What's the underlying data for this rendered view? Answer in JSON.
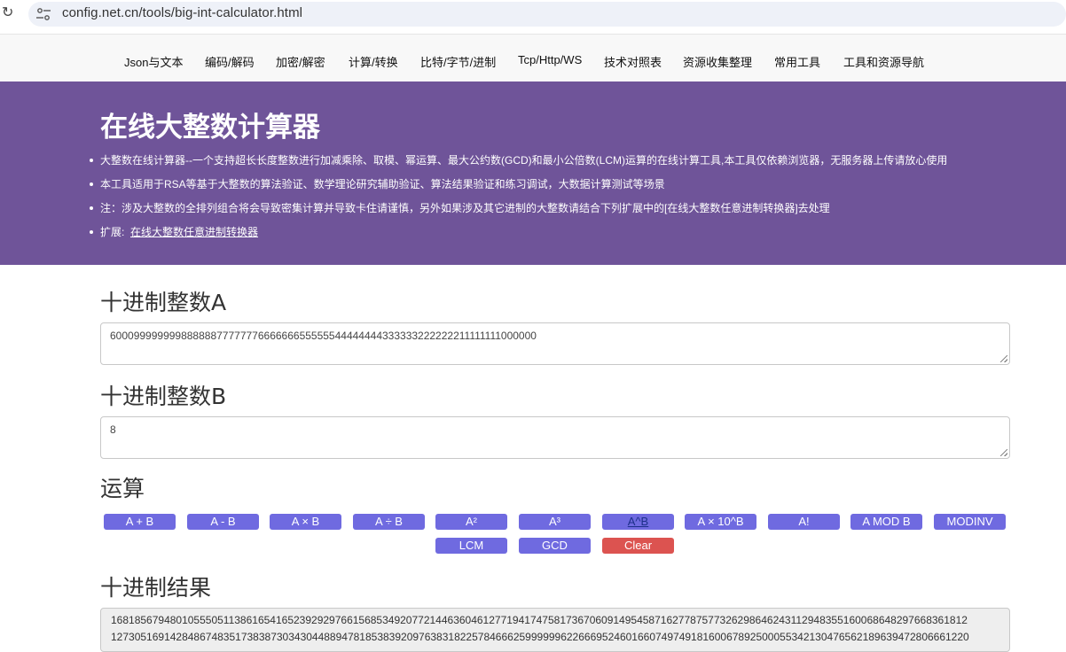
{
  "browser": {
    "url": "config.net.cn/tools/big-int-calculator.html"
  },
  "nav": {
    "items": [
      "Json与文本",
      "编码/解码",
      "加密/解密",
      "计算/转换",
      "比特/字节/进制",
      "Tcp/Http/WS",
      "技术对照表",
      "资源收集整理",
      "常用工具",
      "工具和资源导航"
    ]
  },
  "hero": {
    "title": "在线大整数计算器",
    "bullets": [
      "大整数在线计算器--一个支持超长长度整数进行加减乘除、取模、幂运算、最大公约数(GCD)和最小公倍数(LCM)运算的在线计算工具,本工具仅依赖浏览器，无服务器上传请放心使用",
      "本工具适用于RSA等基于大整数的算法验证、数学理论研究辅助验证、算法结果验证和练习调试，大数据计算测试等场景",
      "注：涉及大整数的全排列组合将会导致密集计算并导致卡住请谨慎，另外如果涉及其它进制的大整数请结合下列扩展中的[在线大整数任意进制转换器]去处理"
    ],
    "ext_label": "扩展:",
    "ext_link": "在线大整数任意进制转换器"
  },
  "inputA": {
    "label": "十进制整数A",
    "value": "6000999999998888887777777666666655555544444444333333222222211111111000000"
  },
  "inputB": {
    "label": "十进制整数B",
    "value": "8"
  },
  "ops": {
    "label": "运算",
    "buttons": [
      "A + B",
      "A - B",
      "A × B",
      "A ÷ B",
      "A²",
      "A³",
      "A^B",
      "A × 10^B",
      "A!",
      "A MOD B",
      "MODINV",
      "LCM",
      "GCD",
      "Clear"
    ]
  },
  "result": {
    "label": "十进制结果",
    "lines": [
      "1681856794801055505113861654165239292976615685349207721446360461277194174758173670609149545871627787577326298646243112948355160068648297668361812",
      "1273051691428486748351738387303430448894781853839209763831822578466625999999622666952460166074974918160067892500055342130476562189639472806661220"
    ]
  }
}
